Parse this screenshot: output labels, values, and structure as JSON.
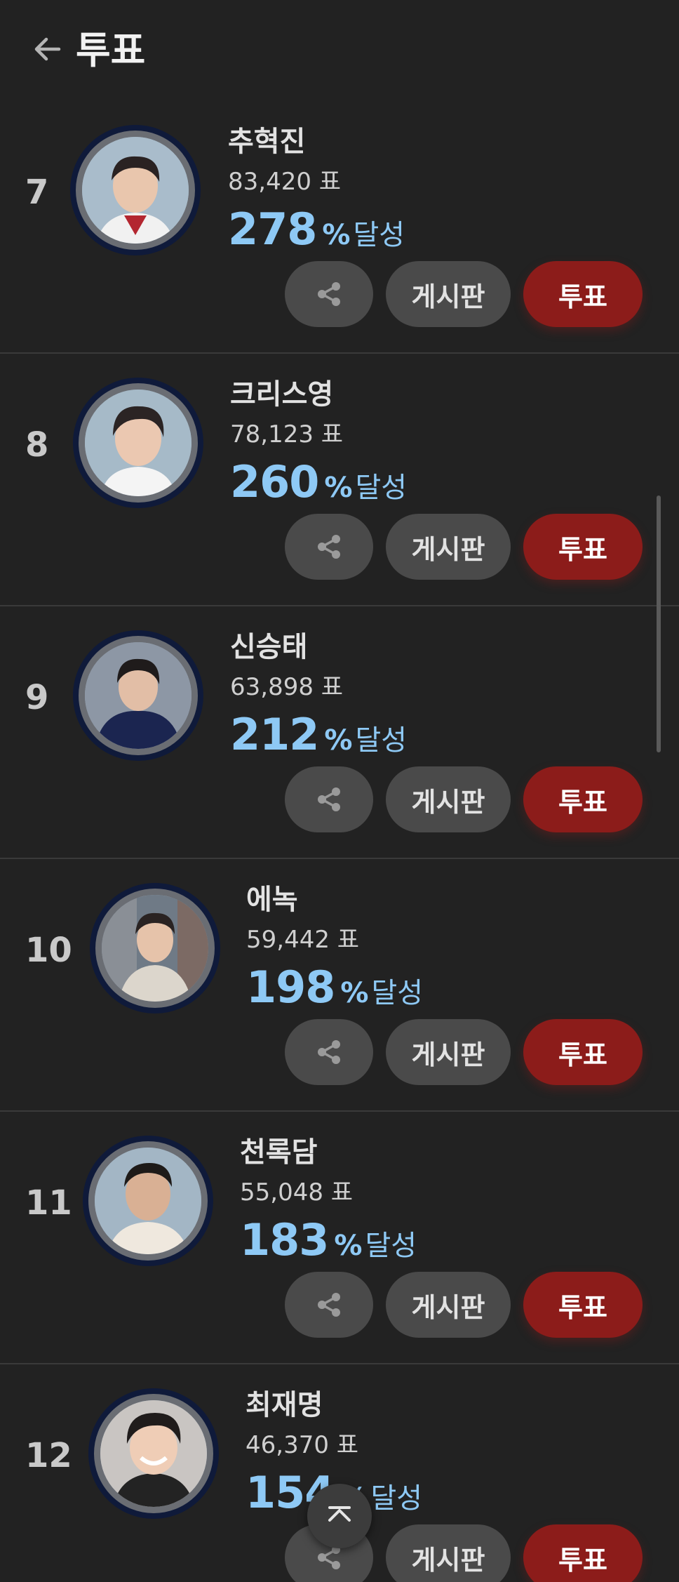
{
  "header": {
    "title": "투표"
  },
  "buttons": {
    "board_label": "게시판",
    "vote_label": "투표"
  },
  "achievement_suffix": "달성",
  "percent_symbol": "%",
  "colors": {
    "background": "#222222",
    "accent_blue": "#8ec9f5",
    "vote_red": "#8c1c1a",
    "button_gray": "#4a4a4a",
    "ring_navy": "#0f1a3a"
  },
  "rows": [
    {
      "rank": "7",
      "name": "추혁진",
      "votes": "83,420 표",
      "percent": "278"
    },
    {
      "rank": "8",
      "name": "크리스영",
      "votes": "78,123 표",
      "percent": "260"
    },
    {
      "rank": "9",
      "name": "신승태",
      "votes": "63,898 표",
      "percent": "212"
    },
    {
      "rank": "10",
      "name": "에녹",
      "votes": "59,442 표",
      "percent": "198"
    },
    {
      "rank": "11",
      "name": "천록담",
      "votes": "55,048 표",
      "percent": "183"
    },
    {
      "rank": "12",
      "name": "최재명",
      "votes": "46,370 표",
      "percent": "154"
    }
  ],
  "icons": {
    "back": "arrow-left-icon",
    "share": "share-icon",
    "scroll_top": "chevron-up-icon"
  }
}
